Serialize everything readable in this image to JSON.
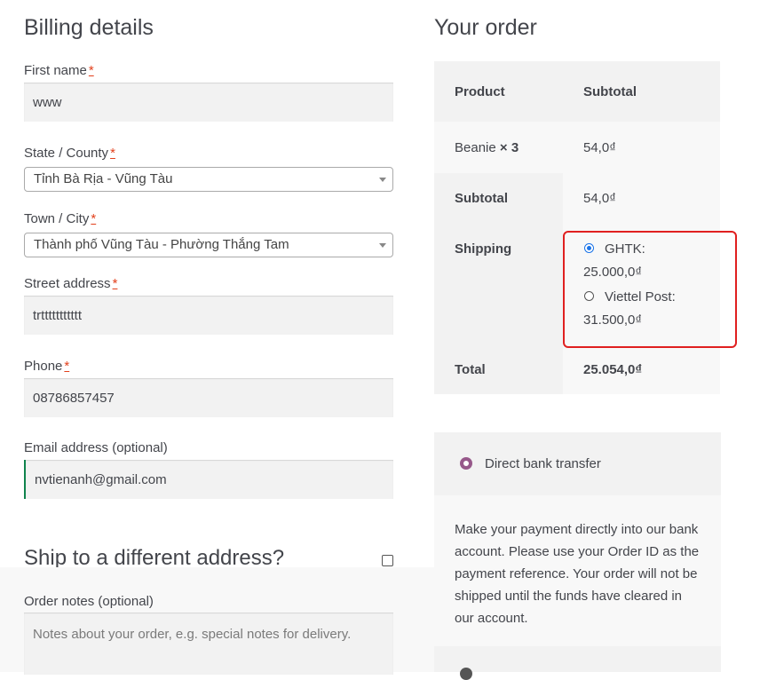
{
  "billing": {
    "heading": "Billing details",
    "required_mark": "*",
    "first_name": {
      "label": "First name",
      "value": "www"
    },
    "state": {
      "label": "State / County",
      "value": "Tỉnh Bà Rịa - Vũng Tàu"
    },
    "town": {
      "label": "Town / City",
      "value": "Thành phố Vũng Tàu - Phường Thắng Tam"
    },
    "street": {
      "label": "Street address",
      "value": "trttttttttttt"
    },
    "phone": {
      "label": "Phone",
      "value": "08786857457"
    },
    "email": {
      "label": "Email address (optional)",
      "value": "nvtienanh@gmail.com"
    }
  },
  "shipping_toggle": {
    "heading": "Ship to a different address?"
  },
  "order_notes": {
    "label": "Order notes (optional)",
    "placeholder": "Notes about your order, e.g. special notes for delivery."
  },
  "order": {
    "heading": "Your order",
    "col_product": "Product",
    "col_subtotal": "Subtotal",
    "item": {
      "name": "Beanie",
      "qty": "× 3",
      "price": "54,0₫"
    },
    "subtotal": {
      "label": "Subtotal",
      "value": "54,0₫"
    },
    "shipping": {
      "label": "Shipping",
      "options": [
        {
          "name": "GHTK:",
          "price": "25.000,0₫",
          "selected": true
        },
        {
          "name": "Viettel Post:",
          "price": "31.500,0₫",
          "selected": false
        }
      ]
    },
    "total": {
      "label": "Total",
      "value": "25.054,0₫"
    }
  },
  "payment": {
    "method": "Direct bank transfer",
    "description": [
      "Make your payment directly into our bank",
      "account. Please use your Order ID as the",
      "payment reference. Your order will not be",
      "shipped until the funds have cleared in",
      "our account."
    ]
  },
  "colors": {
    "highlight_border": "#e02020",
    "accent_purple": "#96588a",
    "email_focus_border": "#0f834d"
  }
}
